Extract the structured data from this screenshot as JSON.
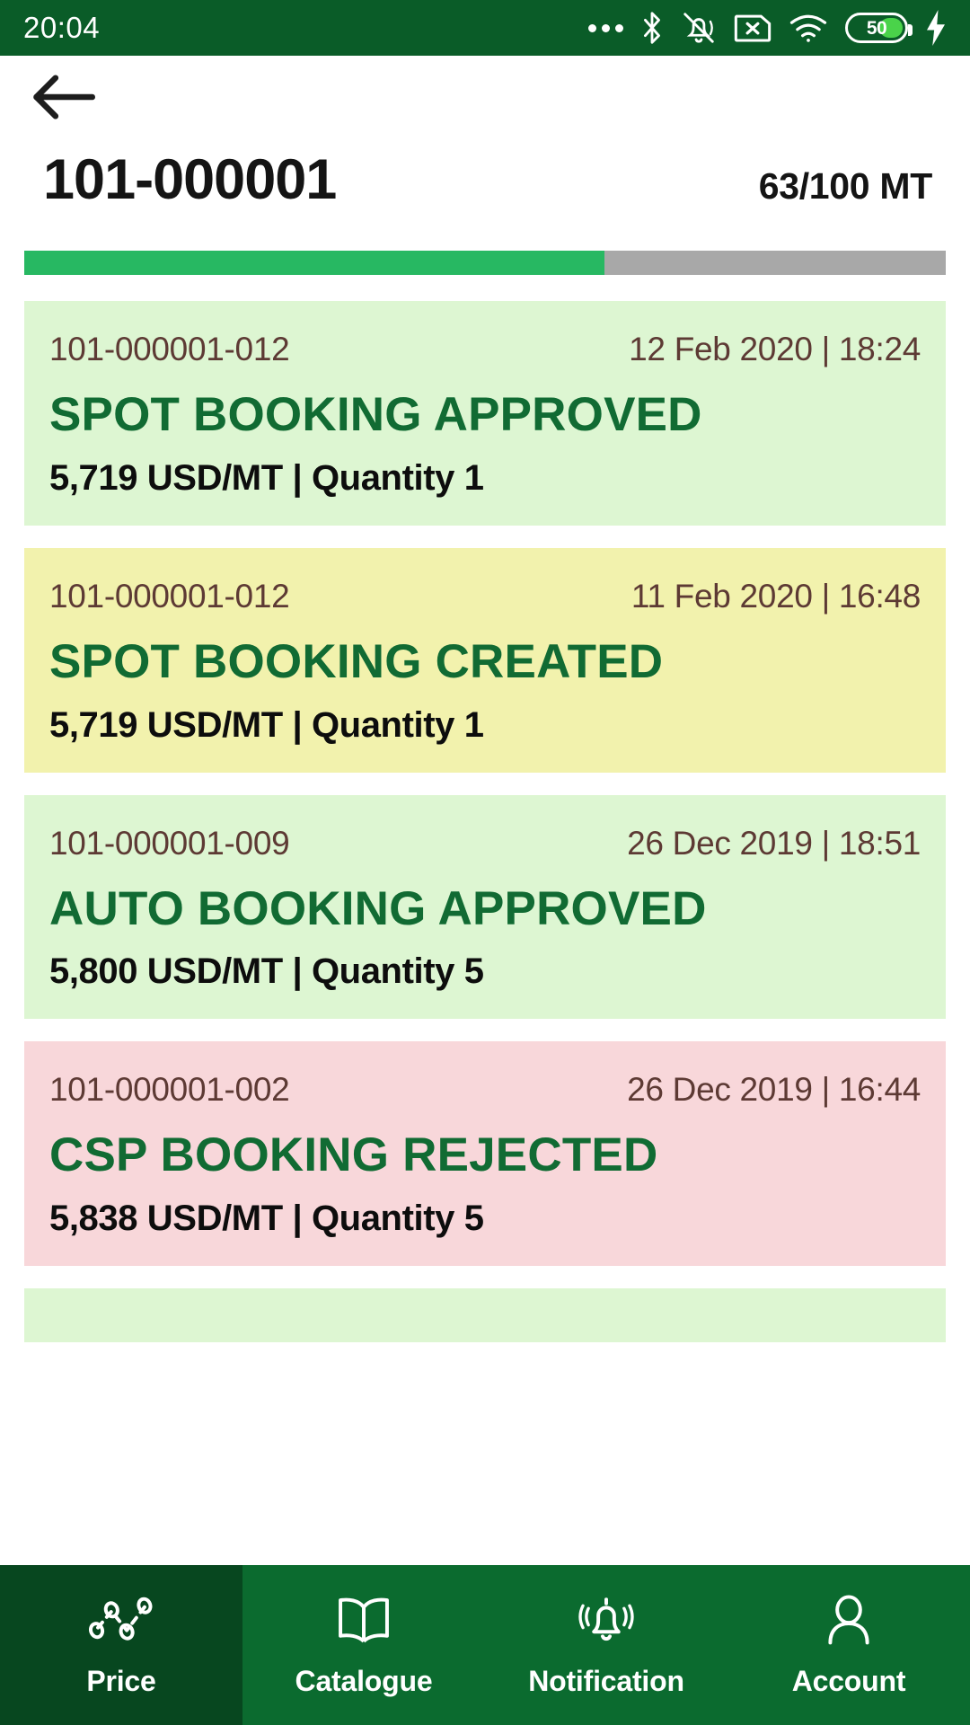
{
  "status_bar": {
    "time": "20:04",
    "battery_level": "50",
    "icons": [
      "ellipsis-icon",
      "bluetooth-icon",
      "vibrate-off-icon",
      "sim-card-error-icon",
      "wifi-icon",
      "battery-icon",
      "charging-bolt-icon"
    ]
  },
  "app_bar": {
    "back_icon": "back-arrow-icon"
  },
  "header": {
    "order_id": "101-000001",
    "quantity_summary": "63/100 MT",
    "progress_percent": 63,
    "progress_fill_color": "#27b862",
    "progress_track_color": "#a8a8a8"
  },
  "bookings": [
    {
      "reference": "101-000001-012",
      "datetime": "12 Feb 2020 | 18:24",
      "status": "SPOT BOOKING APPROVED",
      "meta": "5,719 USD/MT | Quantity 1",
      "bg_color": "#ddf6d2"
    },
    {
      "reference": "101-000001-012",
      "datetime": "11 Feb 2020 | 16:48",
      "status": "SPOT BOOKING CREATED",
      "meta": "5,719 USD/MT | Quantity 1",
      "bg_color": "#f2f2ad"
    },
    {
      "reference": "101-000001-009",
      "datetime": "26 Dec 2019 | 18:51",
      "status": "AUTO BOOKING APPROVED",
      "meta": "5,800 USD/MT | Quantity 5",
      "bg_color": "#ddf6d2"
    },
    {
      "reference": "101-000001-002",
      "datetime": "26 Dec 2019 | 16:44",
      "status": "CSP BOOKING REJECTED",
      "meta": "5,838 USD/MT | Quantity 5",
      "bg_color": "#f8d7da"
    }
  ],
  "partial_card": {
    "bg_color": "#ddf6d2"
  },
  "bottom_nav": {
    "items": [
      {
        "label": "Price",
        "icon": "line-chart-icon",
        "active": true
      },
      {
        "label": "Catalogue",
        "icon": "open-book-icon",
        "active": false
      },
      {
        "label": "Notification",
        "icon": "bell-ring-icon",
        "active": false
      },
      {
        "label": "Account",
        "icon": "person-icon",
        "active": false
      }
    ],
    "active_bg": "#07471f",
    "bg": "#0b6b2f"
  }
}
